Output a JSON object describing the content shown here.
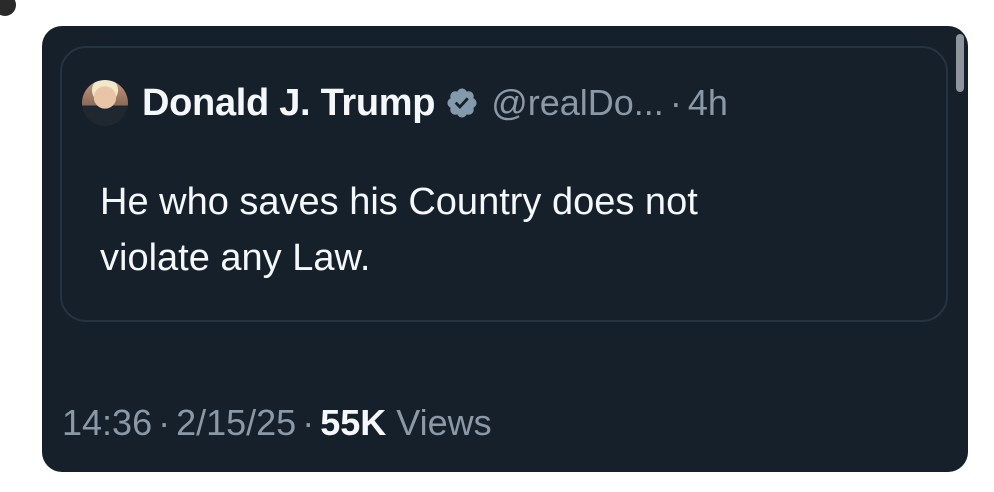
{
  "quoted_post": {
    "author_name": "Donald J. Trump",
    "handle": "@realDo...",
    "separator": "·",
    "time_ago": "4h",
    "text_line1": "He who saves his Country does not",
    "text_line2": "violate any Law."
  },
  "meta": {
    "time": "14:36",
    "separator": "·",
    "date": "2/15/25",
    "views_count": "55K",
    "views_label": "Views"
  },
  "colors": {
    "card_background": "#15202b",
    "primary_text": "#f5f8fa",
    "secondary_text": "#8b98a5",
    "verified_badge": "#829aab"
  },
  "icons": {
    "verified": "verified-badge-icon",
    "avatar": "avatar"
  }
}
